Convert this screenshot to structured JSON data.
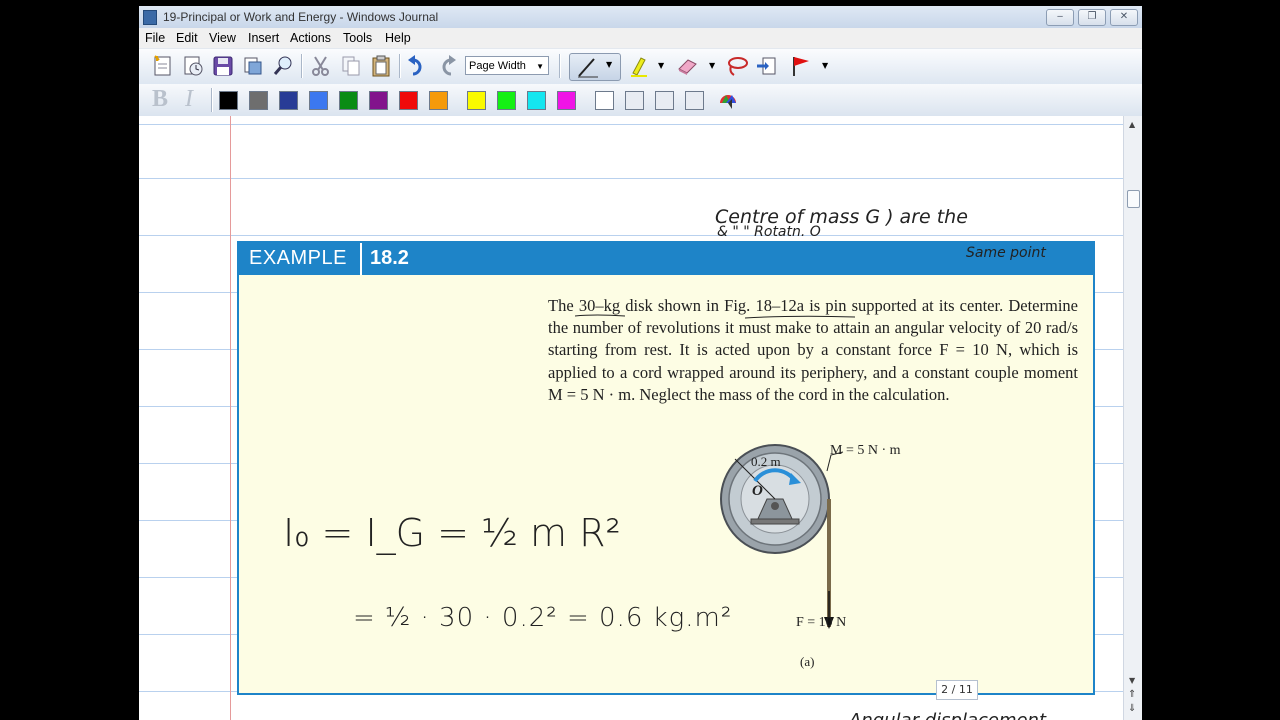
{
  "window": {
    "title": "19-Principal or Work and Energy - Windows Journal",
    "controls": {
      "minimize": "‒",
      "restore": "❐",
      "close": "✕"
    }
  },
  "menu": [
    "File",
    "Edit",
    "View",
    "Insert",
    "Actions",
    "Tools",
    "Help"
  ],
  "toolbar": {
    "zoom_value": "Page Width",
    "bold_label": "B",
    "italic_label": "I",
    "pen_colors": [
      "#000000",
      "#6e6e6e",
      "#283c96",
      "#3c78f0",
      "#0a8c14",
      "#82148c",
      "#f00a0a",
      "#f59a0a",
      "#fafa00",
      "#14f014",
      "#14e6f0",
      "#f014e6",
      "#ffffff",
      "#e8ecf2",
      "#e8ecf2",
      "#e8ecf2"
    ]
  },
  "example": {
    "label": "EXAMPLE",
    "number": "18.2",
    "accent_color": "#1e84c8",
    "problem_text": "The 30–kg disk shown in Fig. 18–12a is pin supported at its center. Determine the number of revolutions it must make to attain an angular velocity of 20 rad/s starting from rest. It is acted upon by a constant force F = 10 N, which is applied to a cord wrapped around its periphery, and a constant couple moment M = 5 N · m. Neglect the mass of the cord in the calculation.",
    "figure": {
      "radius_label": "0.2 m",
      "center_label": "O",
      "moment_label": "M = 5 N · m",
      "force_label": "F = 10 N",
      "caption": "(a)"
    }
  },
  "ink": {
    "note_line1": "Centre of mass G ) are the",
    "note_line2": "& \" \" Rotatn. O",
    "note_line3": "Same point",
    "eq1": "I₀ = I_G = ½ m R²",
    "eq2": "= ½ · 30 · 0.2² = 0.6  kg.m²",
    "bottom_note": "Angular displacement"
  },
  "status": {
    "page_indicator": "2 / 11"
  }
}
